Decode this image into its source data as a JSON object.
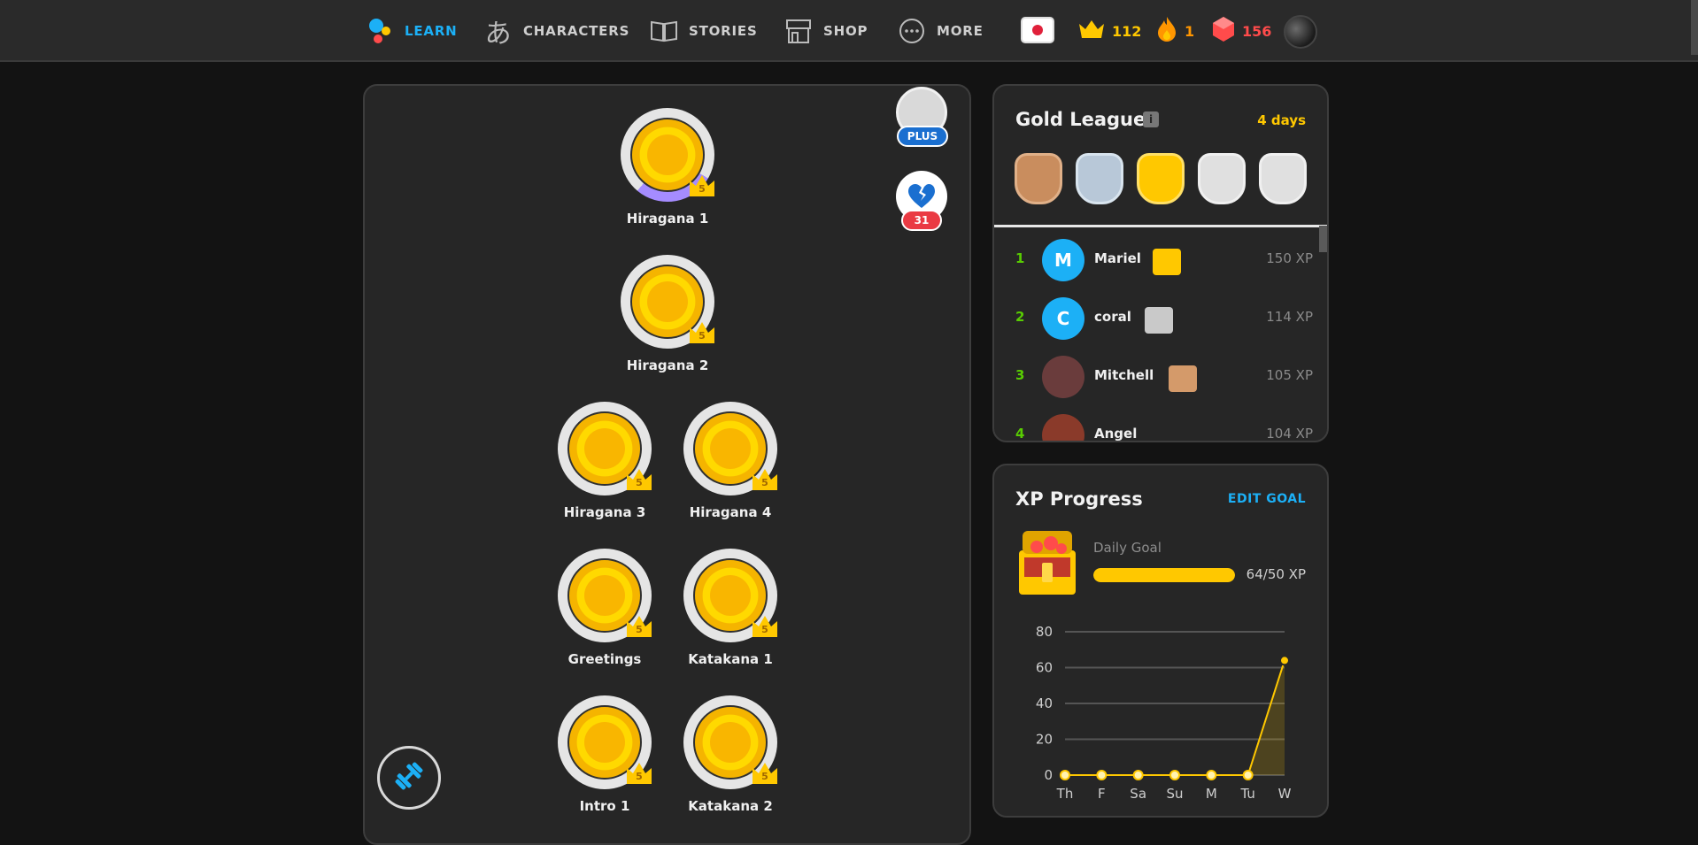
{
  "nav": [
    {
      "label": "LEARN",
      "icon": "learn-icon",
      "active": true
    },
    {
      "label": "CHARACTERS",
      "icon": "characters-icon",
      "glyph": "あ"
    },
    {
      "label": "STORIES",
      "icon": "book-icon"
    },
    {
      "label": "SHOP",
      "icon": "shop-icon"
    },
    {
      "label": "MORE",
      "icon": "more-icon"
    }
  ],
  "stats": {
    "crowns": "112",
    "streak": "1",
    "gems": "156"
  },
  "path": {
    "skills": [
      {
        "label": "Hiragana 1",
        "level": "5"
      },
      {
        "label": "Hiragana 2",
        "level": "5"
      },
      {
        "label": "Hiragana 3",
        "level": "5"
      },
      {
        "label": "Hiragana 4",
        "level": "5"
      },
      {
        "label": "Greetings",
        "level": "5"
      },
      {
        "label": "Katakana 1",
        "level": "5"
      },
      {
        "label": "Intro 1",
        "level": "5"
      },
      {
        "label": "Katakana 2",
        "level": "5"
      }
    ],
    "plus_label": "PLUS",
    "hearts_count": "31"
  },
  "league": {
    "title": "Gold League",
    "info": "i",
    "time_left": "4 days",
    "leaderboard": [
      {
        "rank": "1",
        "initial": "M",
        "name": "Mariel",
        "xp": "150 XP",
        "avatar_color": "#1cb0f6",
        "chest_color": "#ffc800"
      },
      {
        "rank": "2",
        "initial": "C",
        "name": "coral",
        "xp": "114 XP",
        "avatar_color": "#1cb0f6",
        "chest_color": "#c9c9c9"
      },
      {
        "rank": "3",
        "initial": "",
        "name": "Mitchell",
        "xp": "105 XP",
        "avatar_color": "#6a3c3c",
        "chest_color": "#d49a6a"
      },
      {
        "rank": "4",
        "initial": "",
        "name": "Angel",
        "xp": "104 XP",
        "avatar_color": "#8a3a2a",
        "chest_color": ""
      }
    ]
  },
  "xp": {
    "title": "XP Progress",
    "edit_goal": "EDIT GOAL",
    "goal_label": "Daily Goal",
    "goal_value": "64/50 XP",
    "goal_fraction": 1.0
  },
  "chart_data": {
    "type": "line",
    "categories": [
      "Th",
      "F",
      "Sa",
      "Su",
      "M",
      "Tu",
      "W"
    ],
    "values": [
      0,
      0,
      0,
      0,
      0,
      0,
      64
    ],
    "yticks": [
      0,
      20,
      40,
      60,
      80
    ],
    "ylim": [
      0,
      80
    ],
    "grid": true,
    "color": "#ffc800"
  }
}
